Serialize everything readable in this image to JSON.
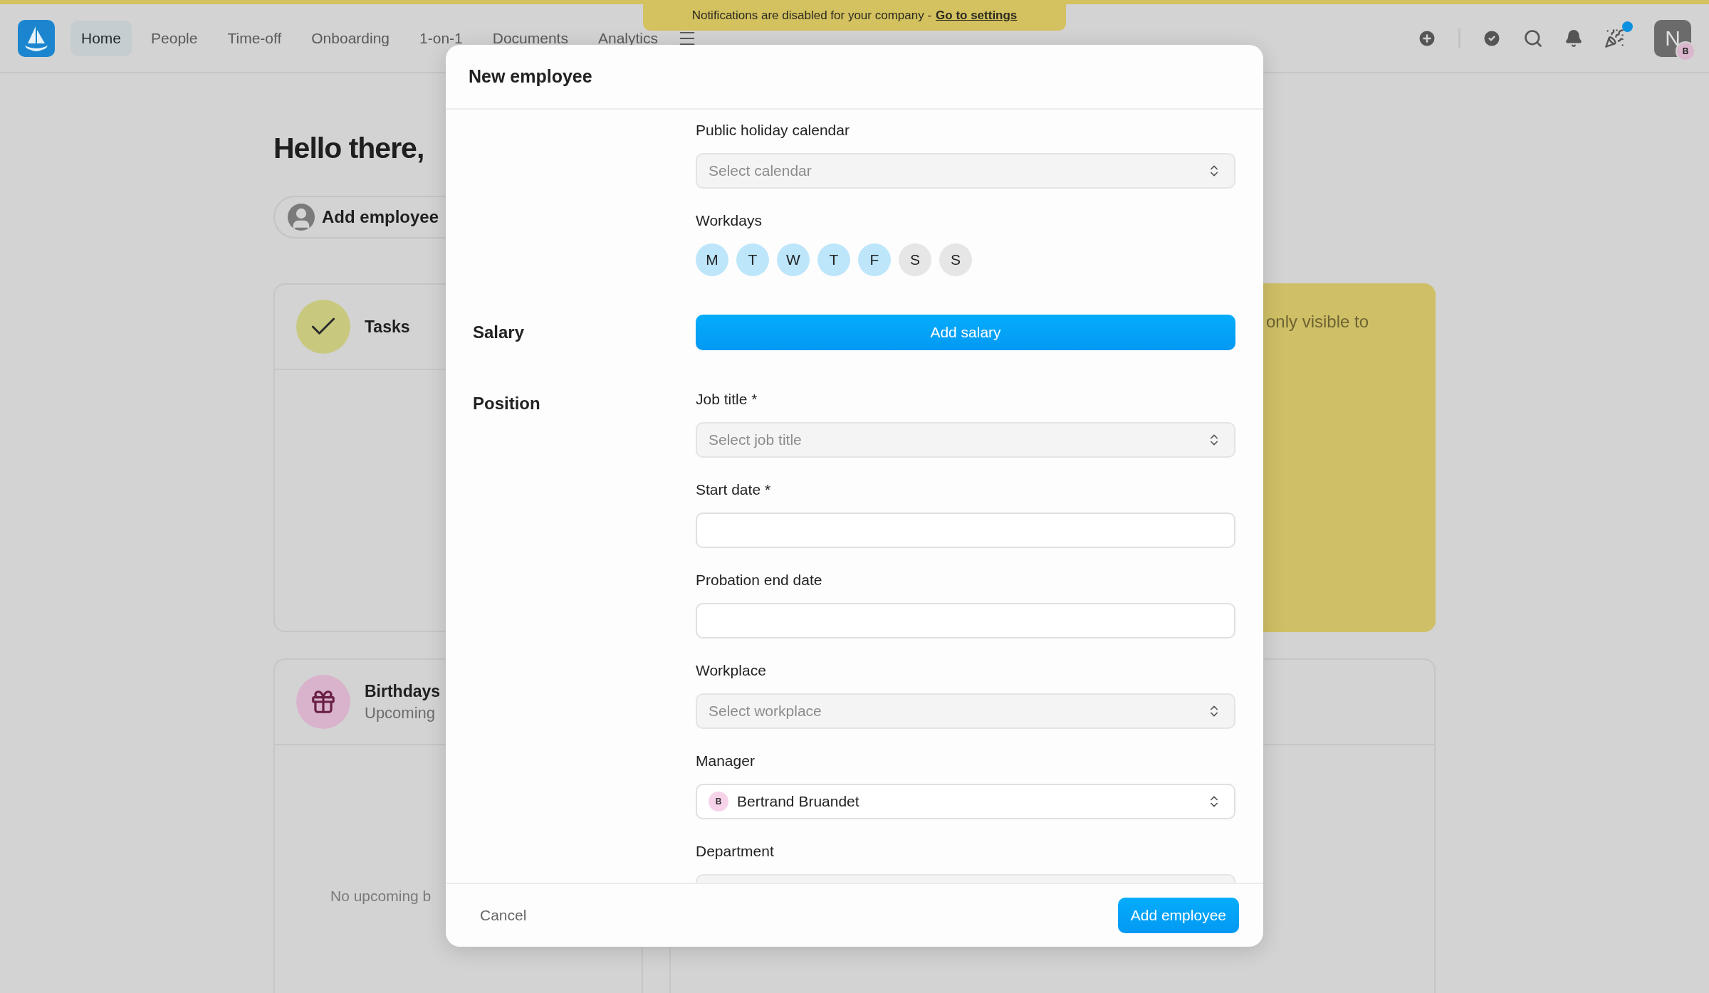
{
  "top_bar": {
    "nav": [
      {
        "label": "Home",
        "selected": true
      },
      {
        "label": "People",
        "selected": false
      },
      {
        "label": "Time-off",
        "selected": false
      },
      {
        "label": "Onboarding",
        "selected": false
      },
      {
        "label": "1-on-1",
        "selected": false
      },
      {
        "label": "Documents",
        "selected": false
      },
      {
        "label": "Analytics",
        "selected": false
      }
    ],
    "notification": {
      "text": "Notifications are disabled for your company -",
      "link": "Go to settings"
    },
    "avatar": {
      "initial": "N",
      "badge": "B"
    }
  },
  "dashboard": {
    "greeting": "Hello there,",
    "add_employee": "Add employee",
    "tasks_title": "Tasks",
    "note_text": "only visible to",
    "birthdays_title": "Birthdays",
    "birthdays_subtitle": "Upcoming",
    "birthdays_empty": "No upcoming b"
  },
  "modal": {
    "title": "New employee",
    "sections": [
      {
        "fields": [
          {
            "kind": "select",
            "label": "Public holiday calendar",
            "placeholder": "Select calendar"
          },
          {
            "kind": "days",
            "label": "Workdays",
            "days": [
              {
                "label": "M",
                "selected": true
              },
              {
                "label": "T",
                "selected": true
              },
              {
                "label": "W",
                "selected": true
              },
              {
                "label": "T",
                "selected": true
              },
              {
                "label": "F",
                "selected": true
              },
              {
                "label": "S",
                "selected": false
              },
              {
                "label": "S",
                "selected": false
              }
            ]
          }
        ]
      },
      {
        "label": "Salary",
        "fields": [
          {
            "kind": "button",
            "text": "Add salary"
          }
        ]
      },
      {
        "label": "Position",
        "fields": [
          {
            "kind": "select",
            "label": "Job title *",
            "placeholder": "Select job title"
          },
          {
            "kind": "date",
            "label": "Start date *"
          },
          {
            "kind": "date",
            "label": "Probation end date"
          },
          {
            "kind": "select",
            "label": "Workplace",
            "placeholder": "Select workplace"
          },
          {
            "kind": "person",
            "label": "Manager",
            "value": "Bertrand Bruandet",
            "initial": "B"
          },
          {
            "kind": "select",
            "label": "Department"
          }
        ]
      }
    ],
    "footer": {
      "cancel": "Cancel",
      "submit": "Add employee"
    }
  }
}
